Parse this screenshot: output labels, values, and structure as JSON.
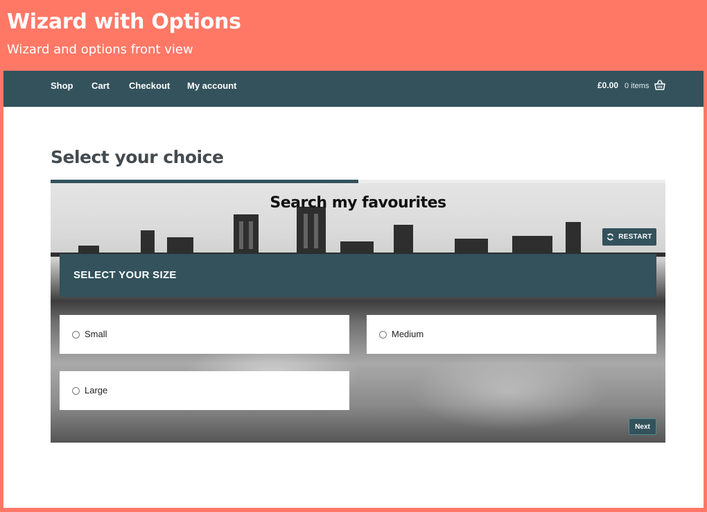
{
  "banner": {
    "title": "Wizard with Options",
    "subtitle": "Wizard and options front view"
  },
  "nav": {
    "items": [
      {
        "label": "Shop"
      },
      {
        "label": "Cart"
      },
      {
        "label": "Checkout"
      },
      {
        "label": "My account"
      }
    ],
    "cart_total": "£0.00",
    "cart_count": "0 items",
    "cart_icon": "basket-icon"
  },
  "page": {
    "title": "Select your choice",
    "progress": 0.5
  },
  "wizard": {
    "heading": "Search my favourites",
    "restart_label": "RESTART",
    "restart_icon": "refresh-icon",
    "step_title": "SELECT YOUR SIZE",
    "options": [
      {
        "label": "Small",
        "selected": false
      },
      {
        "label": "Medium",
        "selected": false
      },
      {
        "label": "Large",
        "selected": false
      }
    ],
    "next_label": "Next"
  },
  "colors": {
    "banner_bg": "#ff7866",
    "theme_dark": "#33525c",
    "title_text": "#444b50"
  }
}
